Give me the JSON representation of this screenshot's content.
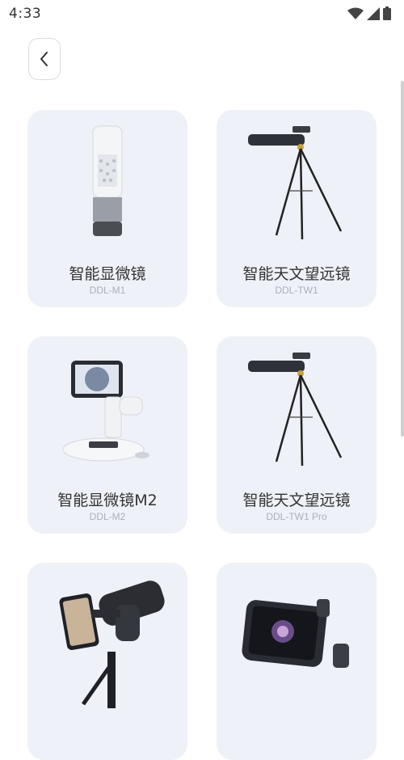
{
  "status_bar": {
    "time": "4:33"
  },
  "products": [
    {
      "name": "智能显微镜",
      "model": "DDL-M1",
      "icon": "microscope-m1"
    },
    {
      "name": "智能天文望远镜",
      "model": "DDL-TW1",
      "icon": "telescope"
    },
    {
      "name": "智能显微镜M2",
      "model": "DDL-M2",
      "icon": "microscope-m2"
    },
    {
      "name": "智能天文望远镜",
      "model": "DDL-TW1 Pro",
      "icon": "telescope"
    },
    {
      "name": "",
      "model": "",
      "icon": "phone-telescope"
    },
    {
      "name": "",
      "model": "",
      "icon": "camera-device"
    }
  ]
}
